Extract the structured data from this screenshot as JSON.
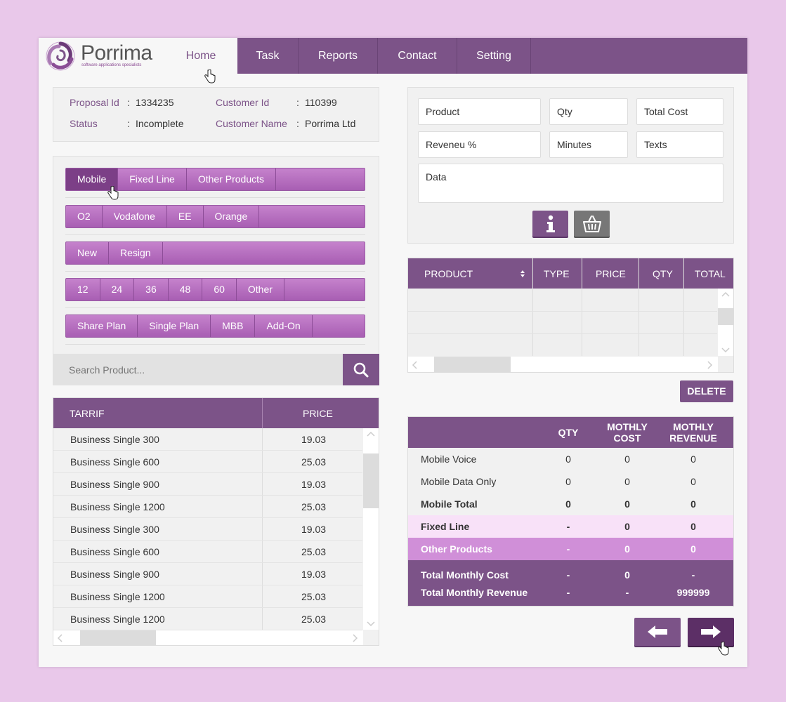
{
  "header": {
    "logo_name": "Porrima",
    "logo_tagline": "software applications specialists",
    "nav": [
      {
        "label": "Home",
        "active": true
      },
      {
        "label": "Task",
        "active": false
      },
      {
        "label": "Reports",
        "active": false
      },
      {
        "label": "Contact",
        "active": false
      },
      {
        "label": "Setting",
        "active": false
      }
    ]
  },
  "info": {
    "proposal_id_label": "Proposal Id",
    "proposal_id": "1334235",
    "customer_id_label": "Customer Id",
    "customer_id": "110399",
    "status_label": "Status",
    "status": "Incomplete",
    "customer_name_label": "Customer Name",
    "customer_name": "Porrima Ltd",
    "colon": ":"
  },
  "filters": {
    "category": [
      "Mobile",
      "Fixed Line",
      "Other Products"
    ],
    "network": [
      "O2",
      "Vodafone",
      "EE",
      "Orange"
    ],
    "contract": [
      "New",
      "Resign"
    ],
    "term": [
      "12",
      "24",
      "36",
      "48",
      "60",
      "Other"
    ],
    "plan": [
      "Share Plan",
      "Single Plan",
      "MBB",
      "Add-On"
    ]
  },
  "search": {
    "placeholder": "Search Product..."
  },
  "tarrif": {
    "headers": {
      "name": "TARRIF",
      "price": "PRICE"
    },
    "rows": [
      {
        "name": "Business Single 300",
        "price": "19.03"
      },
      {
        "name": "Business Single 600",
        "price": "25.03"
      },
      {
        "name": "Business Single 900",
        "price": "19.03"
      },
      {
        "name": "Business Single 1200",
        "price": "25.03"
      },
      {
        "name": "Business Single 300",
        "price": "19.03"
      },
      {
        "name": "Business Single 600",
        "price": "25.03"
      },
      {
        "name": "Business Single 900",
        "price": "19.03"
      },
      {
        "name": "Business Single 1200",
        "price": "25.03"
      },
      {
        "name": "Business Single 1200",
        "price": "25.03"
      }
    ]
  },
  "form": {
    "product": "Product",
    "qty": "Qty",
    "total_cost": "Total Cost",
    "revenue": "Reveneu %",
    "minutes": "Minutes",
    "texts": "Texts",
    "data": "Data"
  },
  "product_grid": {
    "headers": {
      "product": "PRODUCT",
      "type": "TYPE",
      "price": "PRICE",
      "qty": "QTY",
      "total": "TOTAL"
    }
  },
  "delete_label": "DELETE",
  "summary": {
    "headers": {
      "qty": "QTY",
      "cost_1": "MOTHLY",
      "cost_2": "COST",
      "rev_1": "MOTHLY",
      "rev_2": "REVENUE"
    },
    "rows": [
      {
        "label": "Mobile Voice",
        "qty": "0",
        "cost": "0",
        "revenue": "0"
      },
      {
        "label": "Mobile Data Only",
        "qty": "0",
        "cost": "0",
        "revenue": "0"
      },
      {
        "label": "Mobile Total",
        "qty": "0",
        "cost": "0",
        "revenue": "0"
      },
      {
        "label": "Fixed Line",
        "qty": "-",
        "cost": "0",
        "revenue": "0"
      },
      {
        "label": "Other Products",
        "qty": "-",
        "cost": "0",
        "revenue": "0"
      }
    ],
    "totals": [
      {
        "label": "Total Monthly Cost",
        "qty": "-",
        "cost": "0",
        "revenue": "-"
      },
      {
        "label": "Total Monthly Revenue",
        "qty": "-",
        "cost": "-",
        "revenue": "999999"
      }
    ]
  },
  "colors": {
    "primary": "#7c5388",
    "tab_light": "#b86fc1",
    "tab_selected": "#7c3f87",
    "fixed_row": "#f8e1f8",
    "other_row": "#d08fd8",
    "dark_btn": "#5c2f66",
    "gray_btn": "#777777"
  },
  "icons": [
    "swirl-logo-icon",
    "search-icon",
    "info-icon",
    "basket-icon",
    "arrow-left-icon",
    "arrow-right-icon",
    "hand-cursor-icon",
    "sort-icon"
  ]
}
